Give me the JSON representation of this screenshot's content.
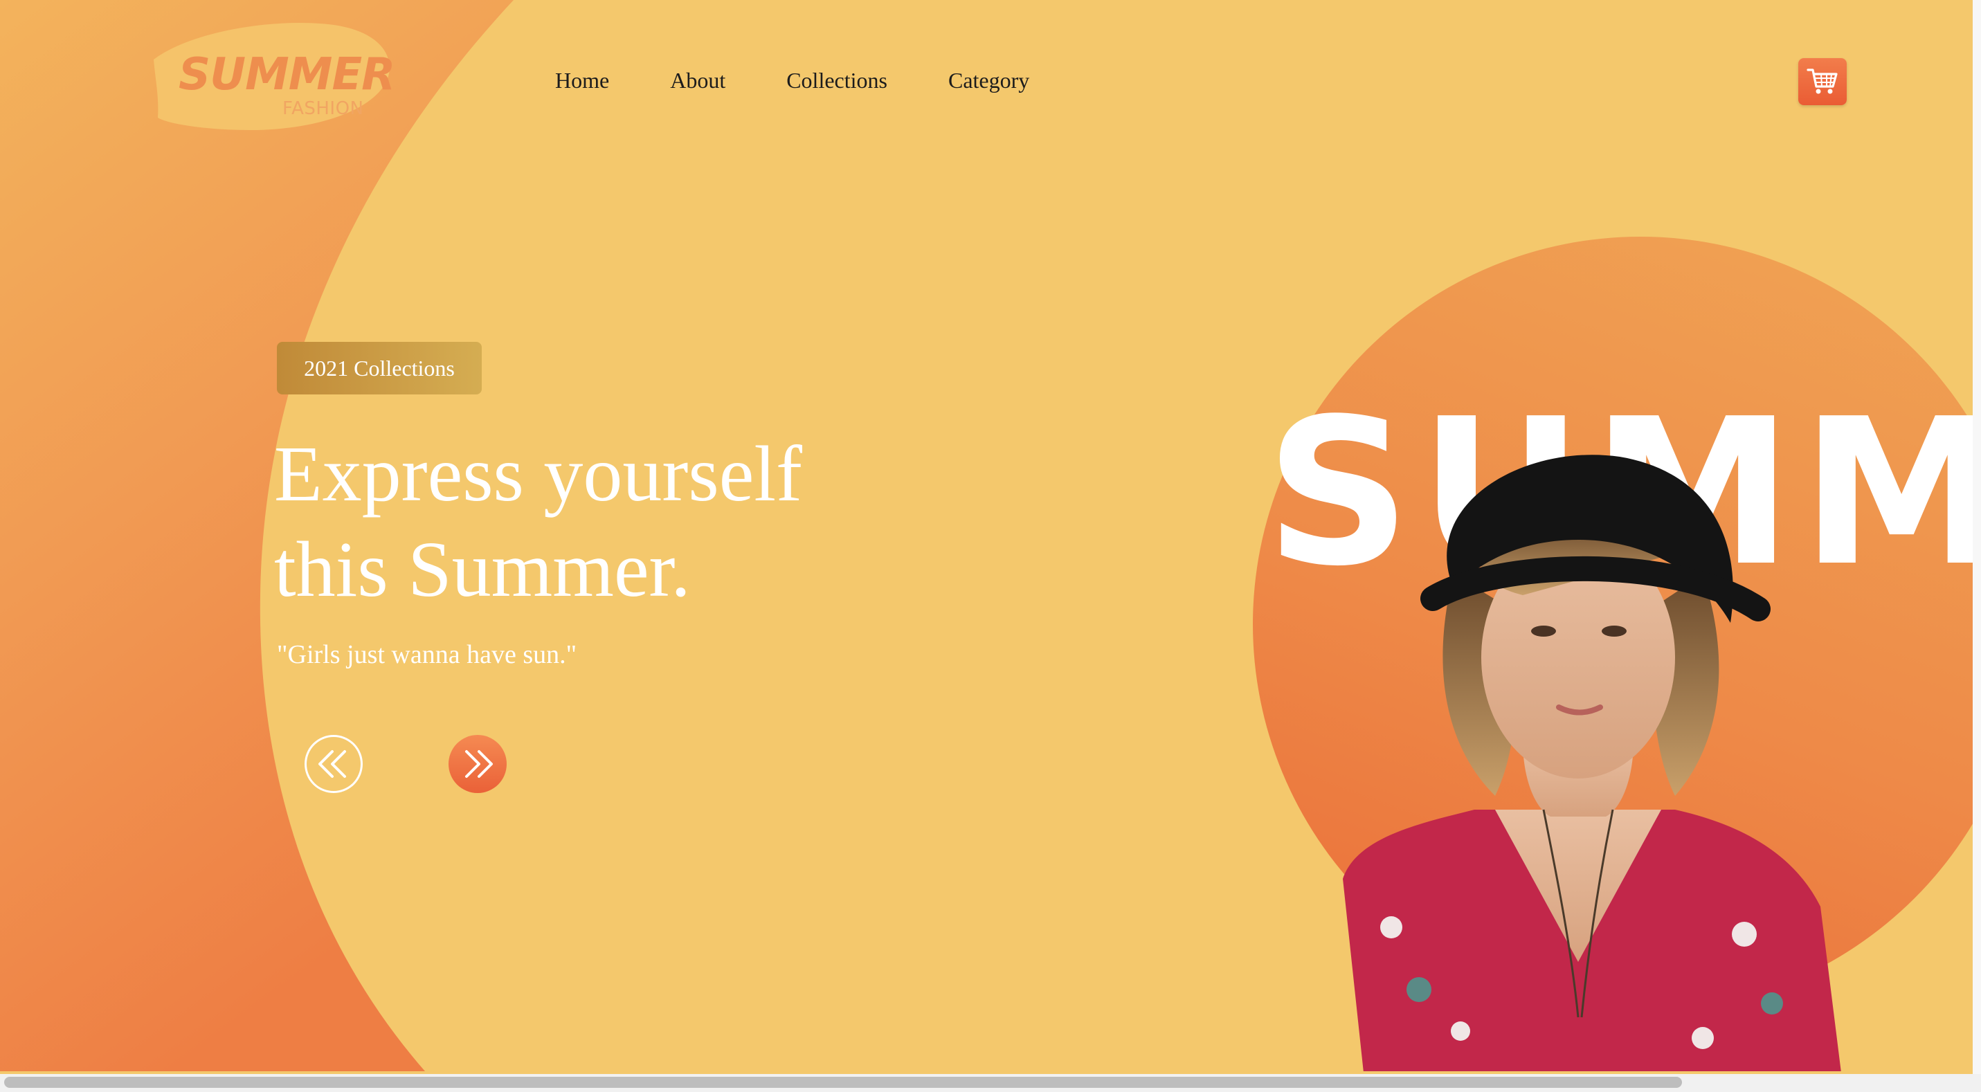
{
  "logo": {
    "main": "SUMMER",
    "sub": "FASHION"
  },
  "nav": {
    "items": [
      "Home",
      "About",
      "Collections",
      "Category"
    ]
  },
  "header": {
    "cart_icon": "shopping-cart-icon"
  },
  "hero": {
    "tag": "2021 Collections",
    "headline_line1": "Express yourself",
    "headline_line2": "this Summer.",
    "quote": "\"Girls just wanna have sun.\"",
    "prev_icon": "double-chevron-left-icon",
    "next_icon": "double-chevron-right-icon",
    "image_word": "SUMMER"
  },
  "colors": {
    "background": "#f4c86c",
    "accent_orange": "#ea6138",
    "tag": "#c9993f",
    "text_dark": "#1c1c1c",
    "text_light": "#ffffff"
  }
}
